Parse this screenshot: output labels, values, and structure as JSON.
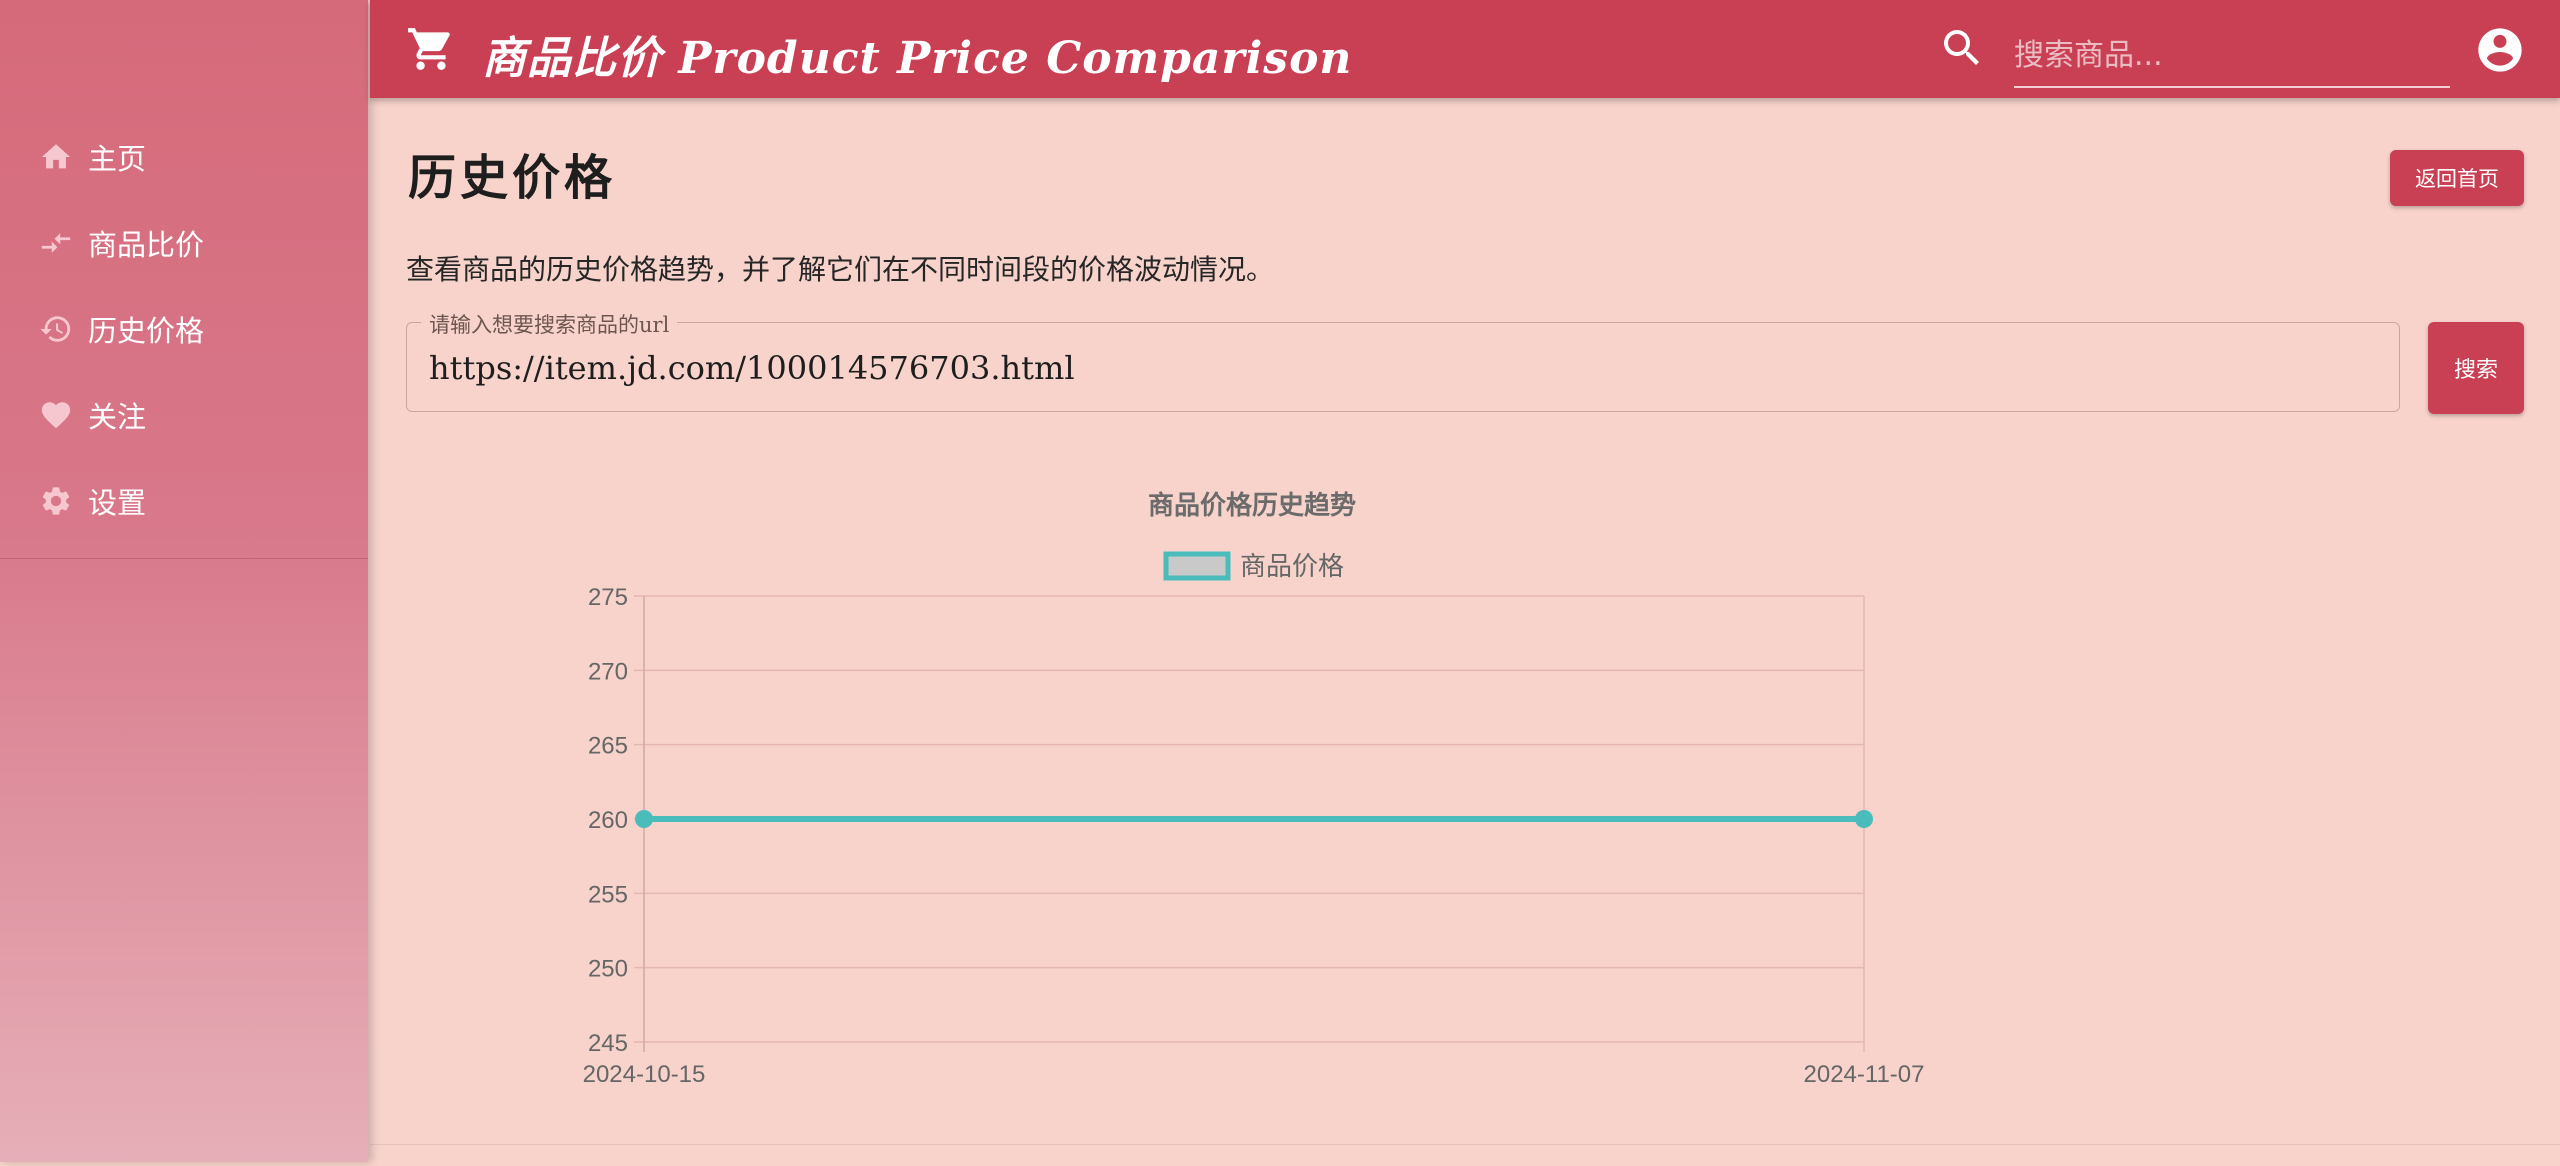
{
  "sidebar": {
    "items": [
      {
        "label": "主页",
        "icon": "home-icon"
      },
      {
        "label": "商品比价",
        "icon": "compare-arrows-icon"
      },
      {
        "label": "历史价格",
        "icon": "history-icon"
      },
      {
        "label": "关注",
        "icon": "heart-icon"
      },
      {
        "label": "设置",
        "icon": "gear-icon"
      }
    ]
  },
  "appbar": {
    "title": "商品比价 Product Price Comparison",
    "search_placeholder": "搜索商品..."
  },
  "main": {
    "page_title": "历史价格",
    "back_button": "返回首页",
    "description": "查看商品的历史价格趋势，并了解它们在不同时间段的价格波动情况。",
    "url_label": "请输入想要搜索商品的url",
    "url_value": "https://item.jd.com/100014576703.html",
    "search_button": "搜索"
  },
  "colors": {
    "primary": "#c94055",
    "background": "#f7d3cb",
    "series": "#4bbcbc"
  },
  "chart_data": {
    "type": "line",
    "title": "商品价格历史趋势",
    "x": [
      "2024-10-15",
      "2024-11-07"
    ],
    "series": [
      {
        "name": "商品价格",
        "values": [
          260,
          260
        ]
      }
    ],
    "ylim": [
      245,
      275
    ],
    "yticks": [
      245,
      250,
      255,
      260,
      265,
      270,
      275
    ],
    "xlabel": "",
    "ylabel": "",
    "grid": true,
    "legend": "top-center"
  }
}
